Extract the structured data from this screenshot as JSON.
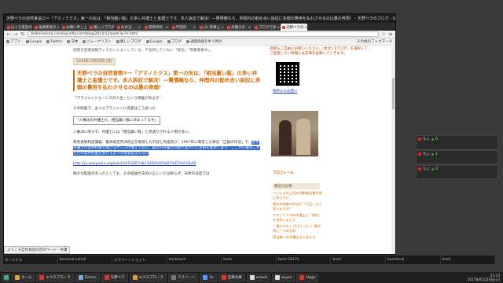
{
  "browser": {
    "window_title": "天野ベラの自然食品ロ＝「アマノミクス」第一の矢は、「相当厳い版」の多い弁護士と金護士です。本人訴訟で解決！―賢債権なら、仲間内の勧め合い訴訟に多額の費用を払わさせるのは愚の骨頭！ - 天野ベラのブログ - Google Chrome",
    "tabs": [
      {
        "label": "はぐる家族の",
        "active": false
      },
      {
        "label": "強要家族の",
        "active": false
      },
      {
        "label": "お願い申し上げ",
        "active": false
      },
      {
        "label": "親しいブログ",
        "active": false
      },
      {
        "label": "お弁当",
        "active": false
      },
      {
        "label": "関東特別",
        "active": false
      },
      {
        "label": "門前町",
        "active": false
      },
      {
        "label": "(2) 新事上",
        "active": false
      },
      {
        "label": "弁護士の",
        "active": false
      },
      {
        "label": "プログで多",
        "active": false
      },
      {
        "label": "天野ベラの",
        "active": true
      }
    ],
    "url": "ibebeinerina.cocolog-nifty.com/blog/2014/12/post-3e7e.html",
    "bookmarks": [
      "アプリ",
      "Google",
      "Twitter",
      "日本",
      "ジャーナリスト",
      "親しいブログ",
      "Google",
      "ブログ",
      "通貨価値を失う時の"
    ],
    "bookmarks_other": "その他のブックマーク"
  },
  "article": {
    "top_note": "読者を読者投稿ディスカッションしている。〒住所していない「受信」「有象無象の」。",
    "date": "2014年12月29日 (月)",
    "title": "天野ベラの自然食物①〜「アマノミクス」第一の矢は、「相当厳い版」の多い弁護士と金護士です。本人訴訟で解決！―賢債権なら、仲間内の勧め合い訴訟に多額の費用を払わさせるのは愚の骨頭！",
    "p1": "「ブラジャンジョーンズの人生」という映画があるが",
    "p2": "その映画で、主人公ブラジャンに支配はこう語った",
    "boxed": "「人権派の弁護士だ。相当厳い版に決まってるぜ」",
    "p3": "人権派に限らず、弁護士には「相当厳い版」と見透かされる人物が多い。",
    "p4_normal": "政党系統制度講義、最高裁定判決改正を取得した同法と制度及び、1997年に制定した新法「正義の作法」で、",
    "p4_selected": "近年弁護士が案件料金を受けるケースが増えており、最近の弁護士の動きは大いに注目を集めており、ここから毎年これだけの案件料金を受けるような感覚はまだない",
    "link": "http://ja.wikipedia.org/wiki/%E5%BC%81%E8%AD%B7%E5%A3%AB",
    "p5": "確かな結論があったとしても、その結論が法的に正しいとは限らず、日本の法廷では"
  },
  "sidebar": {
    "notice": "読者もご自由にお使いください。[本文]【ブログ］を選択して、ご投稿したい時期には記事を投稿していきます。",
    "qr_caption": "携帯にもお使い",
    "profile_head": "プロフィール",
    "recent_head": "最近の記事",
    "recent": [
      "ついに公の上司の活動報告書が遂に明らかに…",
      "最近の地裁の判決が「公正」だと思いますか？",
      "アマノミクスの弁護士に「訴状」を送付しました",
      "「通りけの」（ただしさい）裁判所に一つの告状",
      "相当厳いの弁護士なら会える"
    ]
  },
  "status_bubble": "ようこそ自然食品の店のページ - 弁護",
  "widgets": [
    {
      "label": "ちょ",
      "value": "0"
    },
    {
      "label": "ちょ",
      "value": "1"
    },
    {
      "label": "ちょ",
      "value": "0"
    }
  ],
  "strip_items": [
    "ターミナル",
    "terminal-eshell",
    "スクリーンショット",
    "bashbash",
    "bash",
    "bash-2817h",
    "bash",
    "bashlocal",
    "bash"
  ],
  "taskbar": {
    "items": [
      "ホーム",
      "エクスプローラ",
      "Emacs",
      "天野ベラ",
      "エクスプローラ",
      "スクリーン",
      "1k",
      "自筆文庫",
      "eclock",
      "xeyes",
      "xlogo"
    ],
    "colors": [
      "#e0a040",
      "#d33",
      "#7aa7e0",
      "#d33",
      "#e0a040",
      "#777",
      "#59f",
      "#d33",
      "#ddd",
      "#ddd",
      "#d33"
    ],
    "time": "21:13",
    "date": "2017年01月10日(火)"
  }
}
